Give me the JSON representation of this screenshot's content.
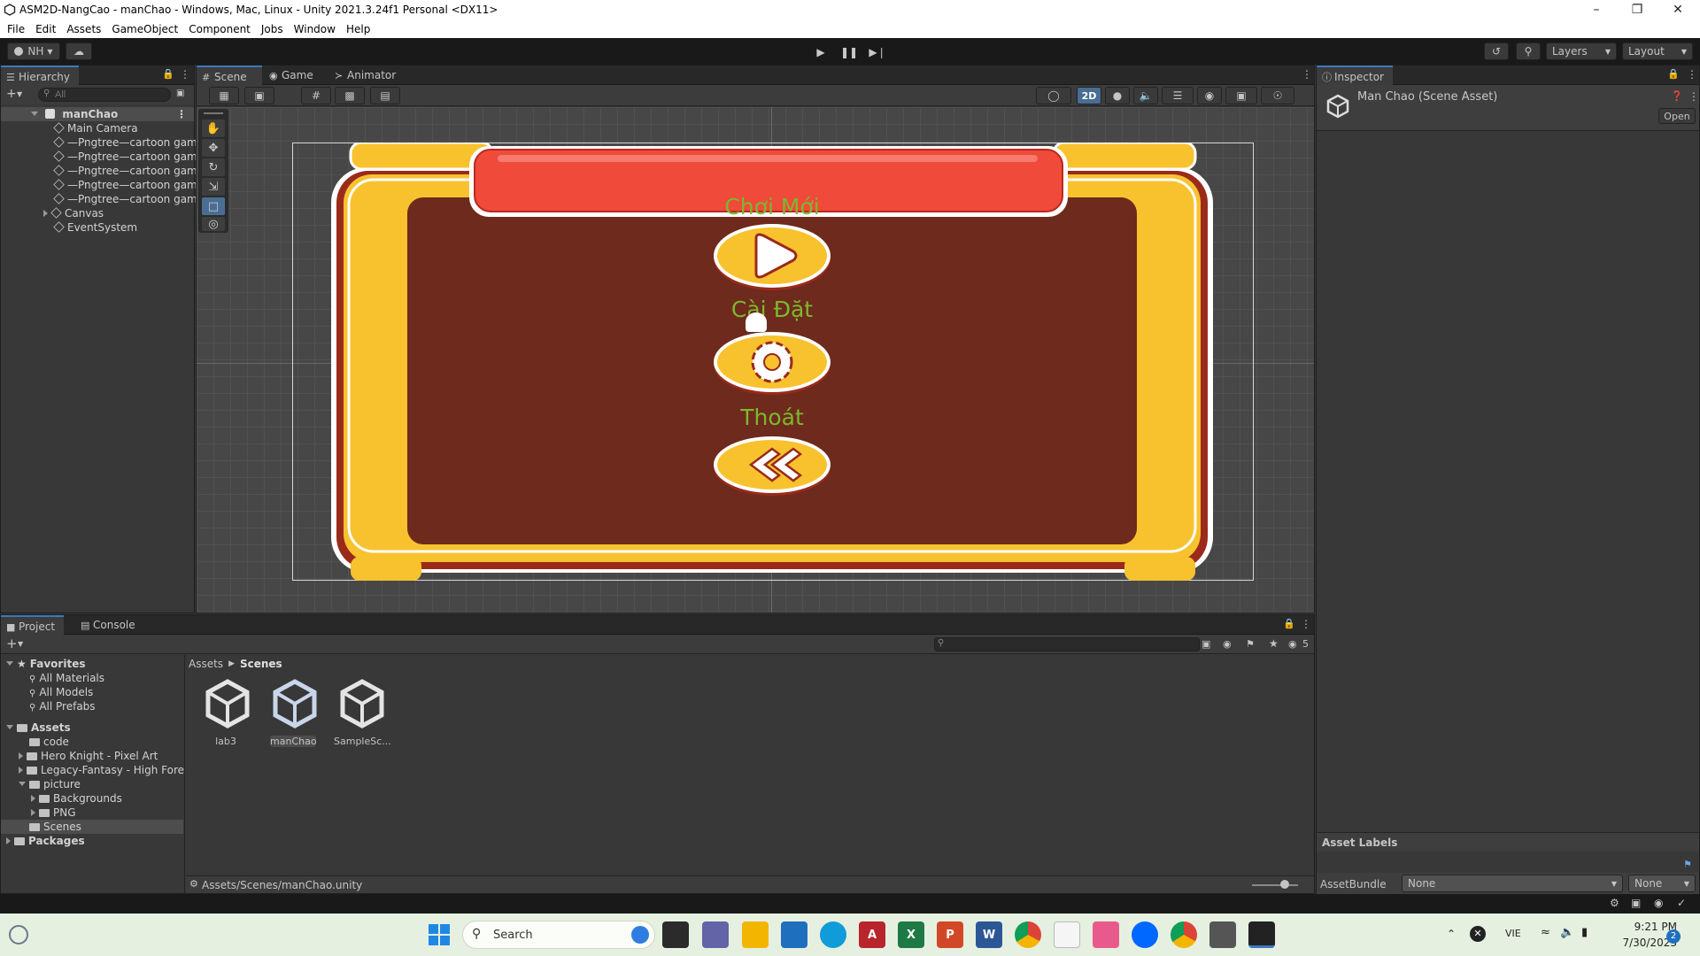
{
  "window": {
    "title": "ASM2D-NangCao - manChao - Windows, Mac, Linux - Unity 2021.3.24f1 Personal <DX11>"
  },
  "menu": [
    "File",
    "Edit",
    "Assets",
    "GameObject",
    "Component",
    "Jobs",
    "Window",
    "Help"
  ],
  "toolbar": {
    "account": "NH",
    "layers": "Layers",
    "layout": "Layout"
  },
  "hierarchy": {
    "tab": "Hierarchy",
    "search_placeholder": "All",
    "scene": "manChao",
    "items": [
      "Main Camera",
      "—Pngtree—cartoon gam",
      "—Pngtree—cartoon gam",
      "—Pngtree—cartoon gam",
      "—Pngtree—cartoon gam",
      "—Pngtree—cartoon gam",
      "Canvas",
      "EventSystem"
    ]
  },
  "scene_tabs": [
    "Scene",
    "Game",
    "Animator"
  ],
  "scene_toolbar": {
    "mode_2d": "2D"
  },
  "game_menu": {
    "play_label": "Chơi Mới",
    "settings_label": "Cài Đặt",
    "exit_label": "Thoát"
  },
  "inspector": {
    "tab": "Inspector",
    "asset_title": "Man Chao (Scene Asset)",
    "open_button": "Open",
    "asset_labels": "Asset Labels",
    "asset_bundle_label": "AssetBundle",
    "asset_bundle_value": "None",
    "asset_variant_value": "None"
  },
  "project": {
    "tabs": [
      "Project",
      "Console"
    ],
    "favorites_label": "Favorites",
    "favorites": [
      "All Materials",
      "All Models",
      "All Prefabs"
    ],
    "assets_label": "Assets",
    "asset_folders": [
      "code",
      "Hero Knight - Pixel Art",
      "Legacy-Fantasy - High Fore",
      "picture"
    ],
    "picture_children": [
      "Backgrounds",
      "PNG"
    ],
    "scenes_folder": "Scenes",
    "packages_label": "Packages",
    "breadcrumb": [
      "Assets",
      "Scenes"
    ],
    "files": [
      "lab3",
      "manChao",
      "SampleSc..."
    ],
    "status_path": "Assets/Scenes/manChao.unity",
    "hidden_count": "5"
  },
  "taskbar": {
    "search_placeholder": "Search",
    "language": "VIE",
    "time": "9:21 PM",
    "date": "7/30/2023",
    "notifications": "2"
  },
  "colors": {
    "frame_yellow": "#f8c22f",
    "frame_red": "#c0392b",
    "panel_brown": "#6e2a1c",
    "banner_red": "#f04a3a",
    "label_green": "#7cb82f",
    "accent_blue": "#3a79bb"
  }
}
